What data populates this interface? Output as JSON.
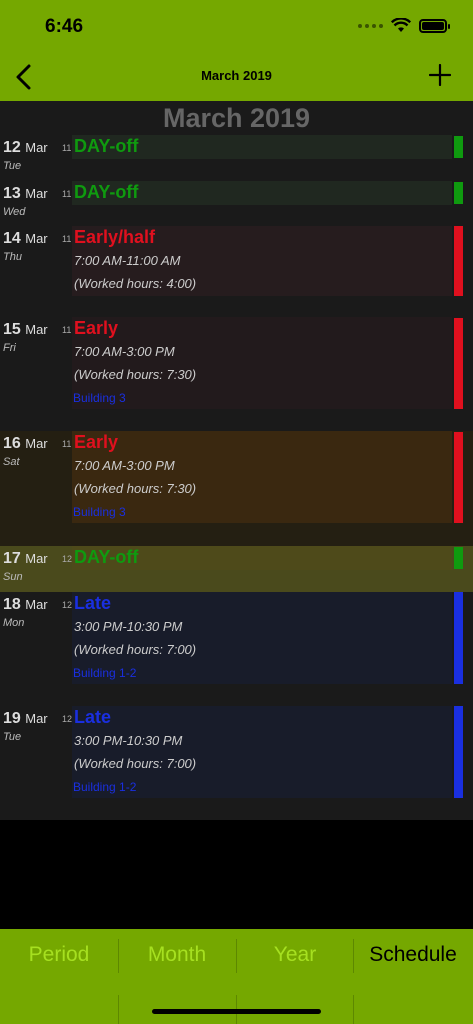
{
  "status": {
    "time": "6:46"
  },
  "nav": {
    "title": "March 2019"
  },
  "month_header": "March 2019",
  "colors": {
    "green": "#0f9a0f",
    "red": "#e0101e",
    "blue": "#1a2fe0",
    "accent": "#75a800"
  },
  "days": [
    {
      "num": "12",
      "mon": "Mar",
      "weekday": "Tue",
      "week": "11",
      "shift": "DAY-off",
      "time": "",
      "hours": "",
      "location": ""
    },
    {
      "num": "13",
      "mon": "Mar",
      "weekday": "Wed",
      "week": "11",
      "shift": "DAY-off",
      "time": "",
      "hours": "",
      "location": ""
    },
    {
      "num": "14",
      "mon": "Mar",
      "weekday": "Thu",
      "week": "11",
      "shift": "Early/half",
      "time": "7:00 AM-11:00 AM",
      "hours": "(Worked hours: 4:00)",
      "location": ""
    },
    {
      "num": "15",
      "mon": "Mar",
      "weekday": "Fri",
      "week": "11",
      "shift": "Early",
      "time": "7:00 AM-3:00 PM",
      "hours": "(Worked hours: 7:30)",
      "location": "Building 3"
    },
    {
      "num": "16",
      "mon": "Mar",
      "weekday": "Sat",
      "week": "11",
      "shift": "Early",
      "time": "7:00 AM-3:00 PM",
      "hours": "(Worked hours: 7:30)",
      "location": "Building 3"
    },
    {
      "num": "17",
      "mon": "Mar",
      "weekday": "Sun",
      "week": "12",
      "shift": "DAY-off",
      "time": "",
      "hours": "",
      "location": ""
    },
    {
      "num": "18",
      "mon": "Mar",
      "weekday": "Mon",
      "week": "12",
      "shift": "Late",
      "time": "3:00 PM-10:30 PM",
      "hours": "(Worked hours: 7:00)",
      "location": "Building 1-2"
    },
    {
      "num": "19",
      "mon": "Mar",
      "weekday": "Tue",
      "week": "12",
      "shift": "Late",
      "time": "3:00 PM-10:30 PM",
      "hours": "(Worked hours: 7:00)",
      "location": "Building 1-2"
    }
  ],
  "tabs": [
    {
      "label": "Period"
    },
    {
      "label": "Month"
    },
    {
      "label": "Year"
    },
    {
      "label": "Schedule"
    }
  ]
}
